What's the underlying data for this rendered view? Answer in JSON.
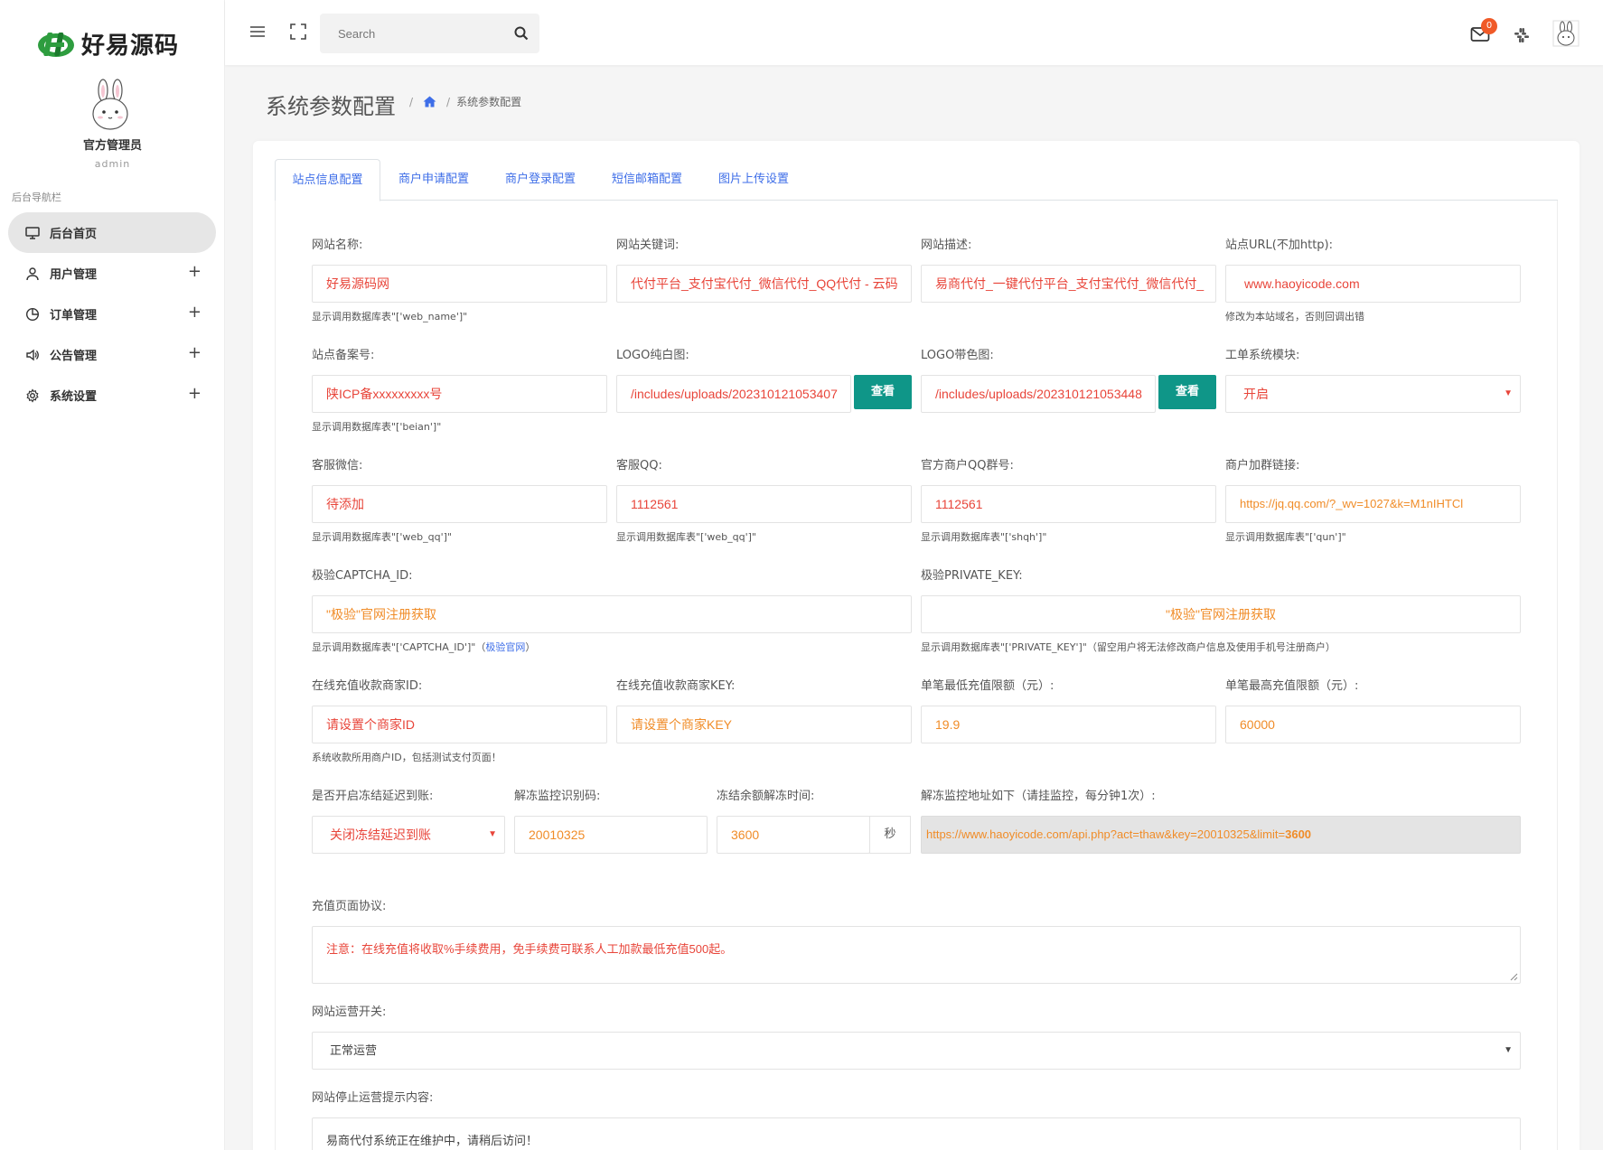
{
  "brand": {
    "name": "好易源码"
  },
  "user": {
    "name": "官方管理员",
    "role": "admin"
  },
  "nav": {
    "title": "后台导航栏",
    "items": [
      {
        "label": "后台首页",
        "icon": "monitor-icon"
      },
      {
        "label": "用户管理",
        "icon": "user-icon"
      },
      {
        "label": "订单管理",
        "icon": "pie-chart-icon"
      },
      {
        "label": "公告管理",
        "icon": "megaphone-icon"
      },
      {
        "label": "系统设置",
        "icon": "gear-icon"
      }
    ],
    "expand_symbol": "+"
  },
  "topbar": {
    "search_placeholder": "Search",
    "mail_badge": "0"
  },
  "page": {
    "title": "系统参数配置",
    "breadcrumb_sep": "/",
    "breadcrumb_current": "系统参数配置"
  },
  "tabs": [
    "站点信息配置",
    "商户申请配置",
    "商户登录配置",
    "短信邮箱配置",
    "图片上传设置"
  ],
  "form": {
    "site_name": {
      "label": "网站名称:",
      "value": "好易源码网",
      "hint": "显示调用数据库表\"['web_name']\""
    },
    "keywords": {
      "label": "网站关键词:",
      "value": "代付平台_支付宝代付_微信代付_QQ代付 - 云码"
    },
    "description": {
      "label": "网站描述:",
      "value": "易商代付_一键代付平台_支付宝代付_微信代付_"
    },
    "site_url": {
      "label": "站点URL(不加http):",
      "value": "www.haoyicode.com",
      "hint": "修改为本站域名，否则回调出错"
    },
    "beian": {
      "label": "站点备案号:",
      "value": "陕ICP备xxxxxxxxx号",
      "hint": "显示调用数据库表\"['beian']\""
    },
    "logo_white": {
      "label": "LOGO纯白图:",
      "value": "/includes/uploads/202310121053407",
      "button": "查看"
    },
    "logo_color": {
      "label": "LOGO带色图:",
      "value": "/includes/uploads/202310121053448",
      "button": "查看"
    },
    "ticket": {
      "label": "工单系统模块:",
      "value": "开启"
    },
    "wechat": {
      "label": "客服微信:",
      "value": "待添加",
      "hint": "显示调用数据库表\"['web_qq']\""
    },
    "qq": {
      "label": "客服QQ:",
      "value": "1112561",
      "hint": "显示调用数据库表\"['web_qq']\""
    },
    "qq_group": {
      "label": "官方商户QQ群号:",
      "value": "1112561",
      "hint": "显示调用数据库表\"['shqh']\""
    },
    "group_link": {
      "label": "商户加群链接:",
      "value": "https://jq.qq.com/?_wv=1027&k=M1nIHTCl",
      "hint": "显示调用数据库表\"['qun']\""
    },
    "captcha_id": {
      "label": "极验CAPTCHA_ID:",
      "value": "\"极验\"官网注册获取",
      "hint": "显示调用数据库表\"['CAPTCHA_ID']\"",
      "hint_link": "极验官网"
    },
    "private_key": {
      "label": "极验PRIVATE_KEY:",
      "value": "\"极验\"官网注册获取",
      "hint": "显示调用数据库表\"['PRIVATE_KEY']\"（留空用户将无法修改商户信息及使用手机号注册商户）"
    },
    "merchant_id": {
      "label": "在线充值收款商家ID:",
      "value": "请设置个商家ID",
      "hint": "系统收款所用商户ID，包括测试支付页面！"
    },
    "merchant_key": {
      "label": "在线充值收款商家KEY:",
      "value": "请设置个商家KEY"
    },
    "min_recharge": {
      "label": "单笔最低充值限额（元）:",
      "value": "19.9"
    },
    "max_recharge": {
      "label": "单笔最高充值限额（元）:",
      "value": "60000"
    },
    "freeze": {
      "label": "是否开启冻结延迟到账:",
      "value": "关闭冻结延迟到账"
    },
    "thaw_code": {
      "label": "解冻监控识别码:",
      "value": "20010325"
    },
    "thaw_time": {
      "label": "冻结余额解冻时间:",
      "value": "3600",
      "unit": "秒"
    },
    "thaw_url": {
      "label": "解冻监控地址如下（请挂监控，每分钟1次）:",
      "value": "https://www.haoyicode.com/api.php?act=thaw&key=20010325&limit=",
      "value_bold": "3600"
    },
    "agreement": {
      "label": "充值页面协议:",
      "value": "注意：在线充值将收取%手续费用，免手续费可联系人工加款最低充值500起。"
    },
    "operation": {
      "label": "网站运营开关:",
      "value": "正常运营"
    },
    "stop_msg": {
      "label": "网站停止运营提示内容:",
      "value": "易商代付系统正在维护中，请稍后访问！"
    }
  },
  "colors": {
    "accent": "#3e6ee8",
    "button": "#0f9688",
    "red_text": "#e8453a",
    "orange_text": "#f08c28",
    "badge": "#f05a28"
  }
}
